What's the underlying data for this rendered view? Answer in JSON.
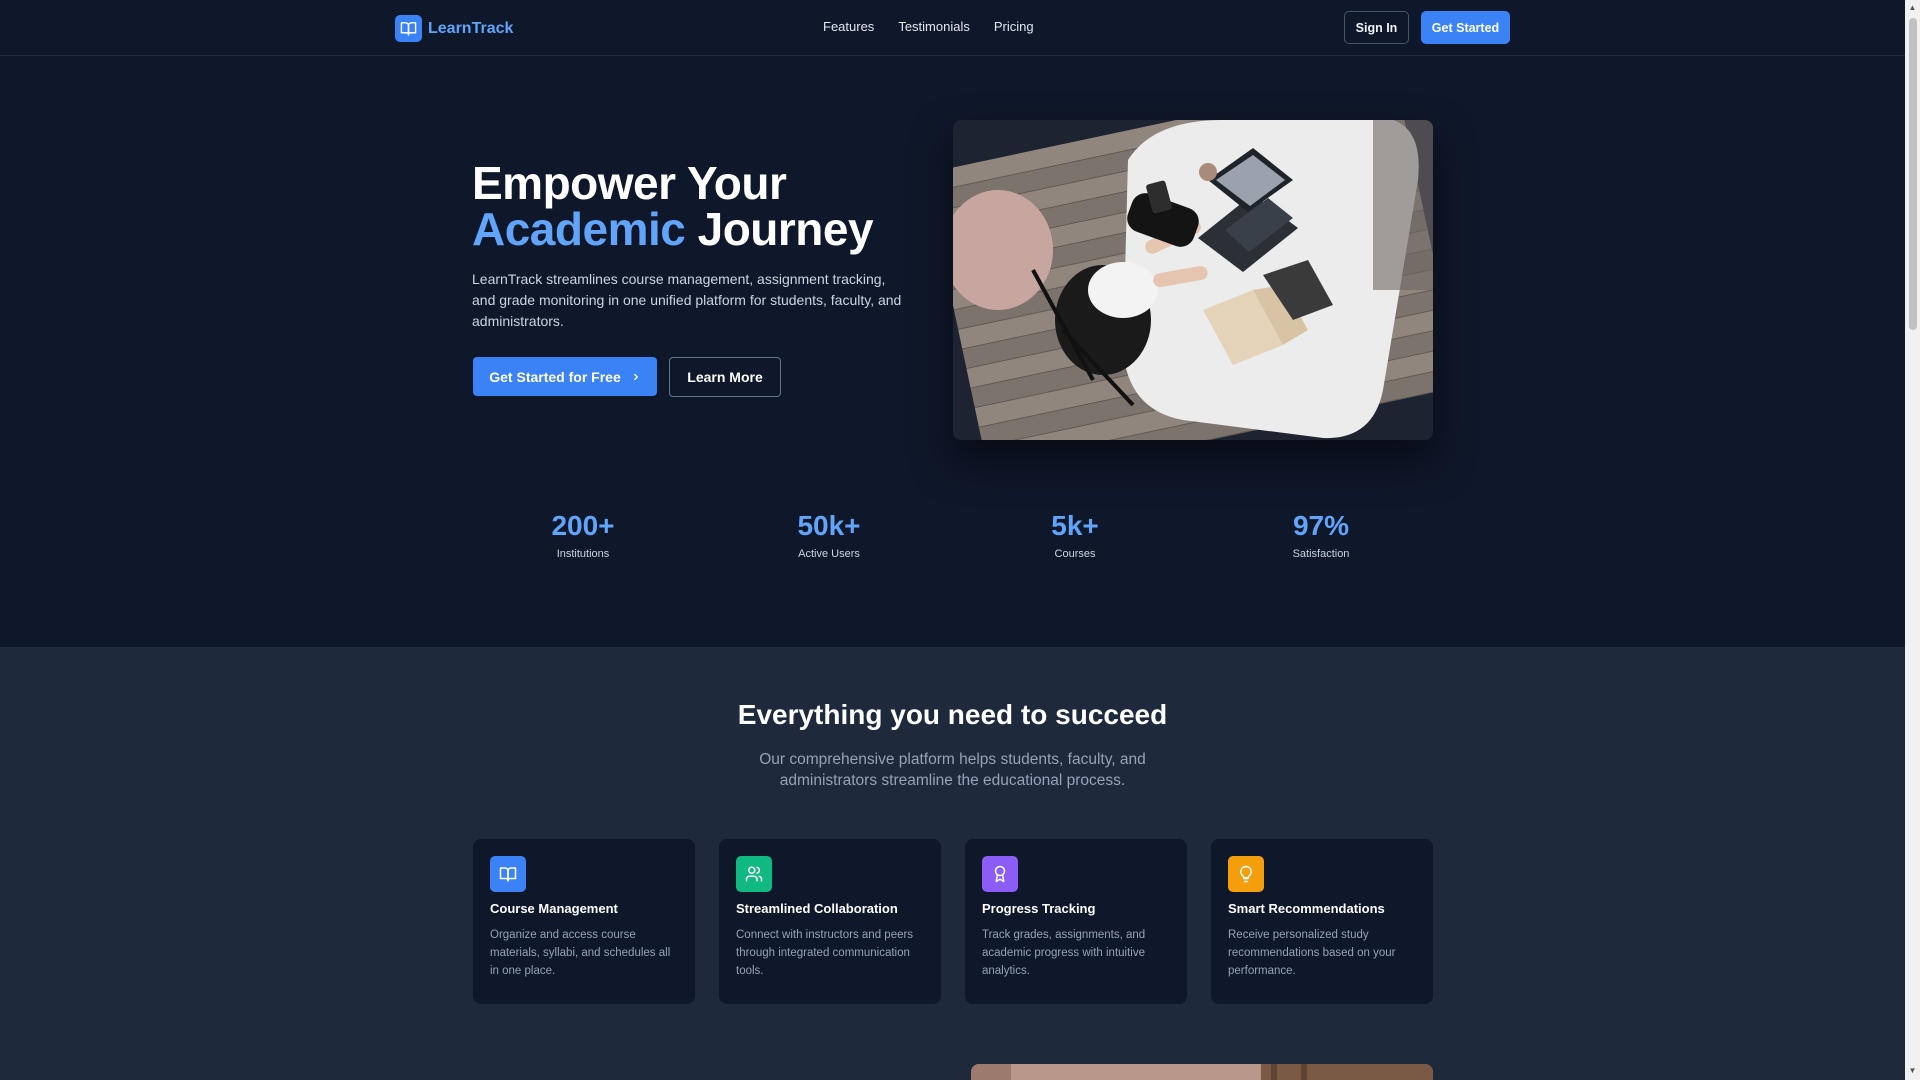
{
  "nav": {
    "brand": "LearnTrack",
    "links": [
      "Features",
      "Testimonials",
      "Pricing"
    ],
    "sign_in": "Sign In",
    "get_started": "Get Started"
  },
  "hero": {
    "title_line1": "Empower Your",
    "title_accent": "Academic",
    "title_rest": " Journey",
    "description": "LearnTrack streamlines course management, assignment tracking, and grade monitoring in one unified platform for students, faculty, and administrators.",
    "primary_cta": "Get Started for Free",
    "secondary_cta": "Learn More",
    "image_icon": "student-laptop-photo"
  },
  "stats": [
    {
      "value": "200+",
      "label": "Institutions"
    },
    {
      "value": "50k+",
      "label": "Active Users"
    },
    {
      "value": "5k+",
      "label": "Courses"
    },
    {
      "value": "97%",
      "label": "Satisfaction"
    }
  ],
  "features": {
    "title": "Everything you need to succeed",
    "subtitle_line1": "Our comprehensive platform helps students, faculty, and",
    "subtitle_line2": "administrators streamline the educational process.",
    "cards": [
      {
        "title": "Course Management",
        "description": "Organize and access course materials, syllabi, and schedules all in one place.",
        "icon": "book-icon",
        "color": "#3b82f6"
      },
      {
        "title": "Streamlined Collaboration",
        "description": "Connect with instructors and peers through integrated communication tools.",
        "icon": "users-icon",
        "color": "#10b981"
      },
      {
        "title": "Progress Tracking",
        "description": "Track grades, assignments, and academic progress with intuitive analytics.",
        "icon": "award-icon",
        "color": "#8b5cf6"
      },
      {
        "title": "Smart Recommendations",
        "description": "Receive personalized study recommendations based on your performance.",
        "icon": "lightbulb-icon",
        "color": "#f59e0b"
      }
    ]
  },
  "colors": {
    "background": "#0f172a",
    "section_background": "#1e293b",
    "accent": "#3b82f6",
    "accent_light": "#60a5fa"
  }
}
